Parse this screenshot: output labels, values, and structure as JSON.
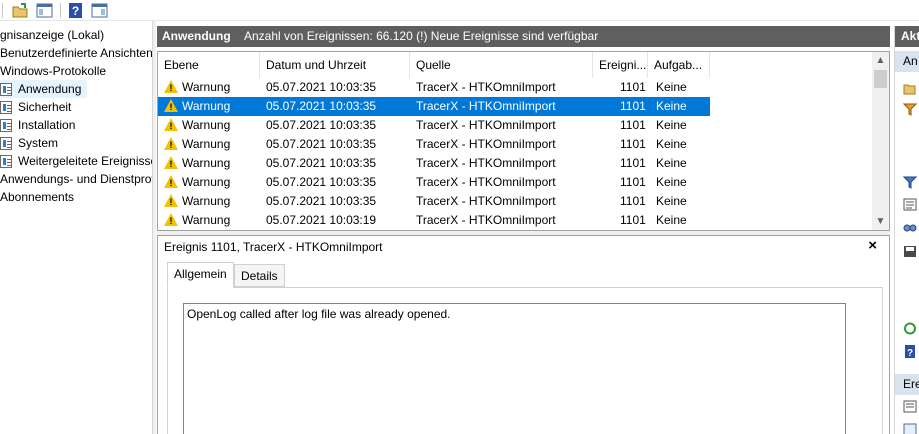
{
  "tree": {
    "items": [
      {
        "label": "gnisanzeige (Lokal)",
        "indent": 0
      },
      {
        "label": "Benutzerdefinierte Ansichten",
        "indent": 0
      },
      {
        "label": "Windows-Protokolle",
        "indent": 0
      },
      {
        "label": "Anwendung",
        "indent": 1,
        "selected": true
      },
      {
        "label": "Sicherheit",
        "indent": 1
      },
      {
        "label": "Installation",
        "indent": 1
      },
      {
        "label": "System",
        "indent": 1
      },
      {
        "label": "Weitergeleitete Ereignisse",
        "indent": 1
      },
      {
        "label": "Anwendungs- und Dienstprotokolle",
        "indent": 0
      },
      {
        "label": "Abonnements",
        "indent": 0
      }
    ]
  },
  "center": {
    "title": "Anwendung",
    "message": "Anzahl von Ereignissen: 66.120 (!) Neue Ereignisse sind verfügbar"
  },
  "events": {
    "columns": [
      "Ebene",
      "Datum und Uhrzeit",
      "Quelle",
      "Ereigni...",
      "Aufgab..."
    ],
    "rows": [
      {
        "level": "Warnung",
        "date": "05.07.2021 10:03:35",
        "source": "TracerX - HTKOmniImport",
        "id": "1101",
        "task": "Keine",
        "selected": false
      },
      {
        "level": "Warnung",
        "date": "05.07.2021 10:03:35",
        "source": "TracerX - HTKOmniImport",
        "id": "1101",
        "task": "Keine",
        "selected": true
      },
      {
        "level": "Warnung",
        "date": "05.07.2021 10:03:35",
        "source": "TracerX - HTKOmniImport",
        "id": "1101",
        "task": "Keine",
        "selected": false
      },
      {
        "level": "Warnung",
        "date": "05.07.2021 10:03:35",
        "source": "TracerX - HTKOmniImport",
        "id": "1101",
        "task": "Keine",
        "selected": false
      },
      {
        "level": "Warnung",
        "date": "05.07.2021 10:03:35",
        "source": "TracerX - HTKOmniImport",
        "id": "1101",
        "task": "Keine",
        "selected": false
      },
      {
        "level": "Warnung",
        "date": "05.07.2021 10:03:35",
        "source": "TracerX - HTKOmniImport",
        "id": "1101",
        "task": "Keine",
        "selected": false
      },
      {
        "level": "Warnung",
        "date": "05.07.2021 10:03:35",
        "source": "TracerX - HTKOmniImport",
        "id": "1101",
        "task": "Keine",
        "selected": false
      },
      {
        "level": "Warnung",
        "date": "05.07.2021 10:03:19",
        "source": "TracerX - HTKOmniImport",
        "id": "1101",
        "task": "Keine",
        "selected": false
      }
    ]
  },
  "details": {
    "title": "Ereignis 1101, TracerX - HTKOmniImport",
    "close": "×",
    "tabs": [
      "Allgemein",
      "Details"
    ],
    "message": "OpenLog called after log file was already opened."
  },
  "actions": {
    "header": "Akt",
    "sub1": "An",
    "sub2": "Ere"
  },
  "colors": {
    "header_bg": "#5f5f5f",
    "selection": "#0078d7",
    "warning": "#f2c200"
  }
}
